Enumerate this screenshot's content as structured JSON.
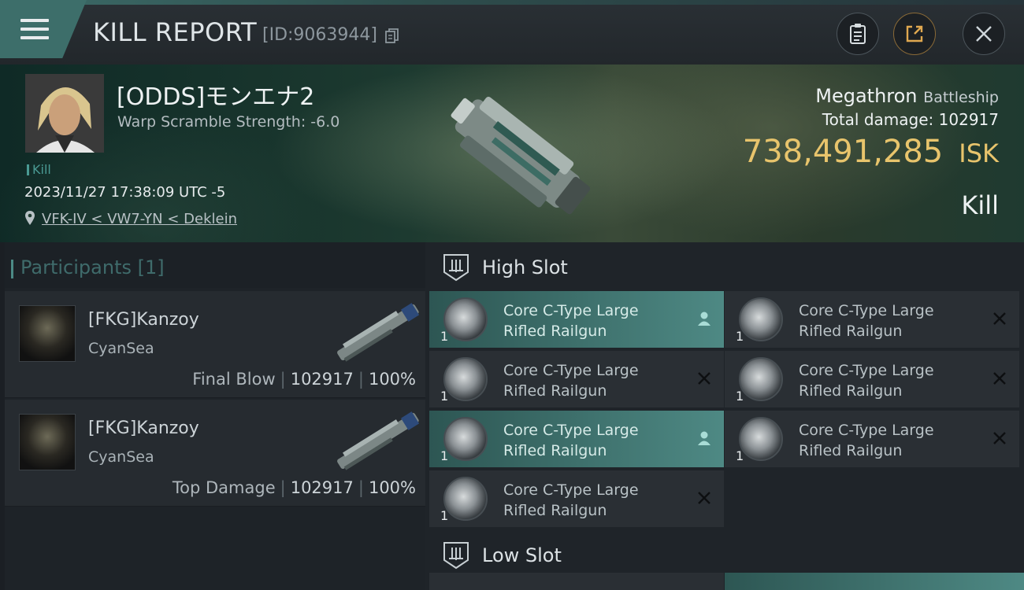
{
  "header": {
    "title": "KILL REPORT",
    "report_id": "[ID:9063944]"
  },
  "victim": {
    "name": "[ODDS]モンエナ2",
    "warp_scramble": "Warp Scramble Strength: -6.0",
    "tag": "Kill",
    "datetime": "2023/11/27 17:38:09 UTC -5",
    "location": "VFK-IV < VW7-YN < Deklein"
  },
  "ship": {
    "name": "Megathron",
    "class": "Battleship",
    "total_damage_label": "Total damage:",
    "total_damage": "102917",
    "isk_value": "738,491,285",
    "isk_unit": "ISK",
    "result": "Kill"
  },
  "participants": {
    "title": "Participants [1]",
    "items": [
      {
        "name": "[FKG]Kanzoy",
        "corp": "CyanSea",
        "role": "Final Blow",
        "damage": "102917",
        "percent": "100%"
      },
      {
        "name": "[FKG]Kanzoy",
        "corp": "CyanSea",
        "role": "Top Damage",
        "damage": "102917",
        "percent": "100%"
      }
    ]
  },
  "high_slot": {
    "label": "High Slot",
    "modules": [
      {
        "qty": "1",
        "name_line1": "Core C-Type Large",
        "name_line2": "Rifled Railgun",
        "status": "person-icon",
        "highlighted": true
      },
      {
        "qty": "1",
        "name_line1": "Core C-Type Large",
        "name_line2": "Rifled Railgun",
        "status": "x-icon",
        "highlighted": false
      },
      {
        "qty": "1",
        "name_line1": "Core C-Type Large",
        "name_line2": "Rifled Railgun",
        "status": "x-icon",
        "highlighted": false
      },
      {
        "qty": "1",
        "name_line1": "Core C-Type Large",
        "name_line2": "Rifled Railgun",
        "status": "x-icon",
        "highlighted": false
      },
      {
        "qty": "1",
        "name_line1": "Core C-Type Large",
        "name_line2": "Rifled Railgun",
        "status": "person-icon",
        "highlighted": true
      },
      {
        "qty": "1",
        "name_line1": "Core C-Type Large",
        "name_line2": "Rifled Railgun",
        "status": "x-icon",
        "highlighted": false
      },
      {
        "qty": "1",
        "name_line1": "Core C-Type Large",
        "name_line2": "Rifled Railgun",
        "status": "x-icon",
        "highlighted": false
      }
    ]
  },
  "low_slot": {
    "label": "Low Slot"
  },
  "colors": {
    "accent_teal": "#4e8984",
    "isk_gold": "#e8c46c",
    "header_tab": "#3d6e6a"
  }
}
